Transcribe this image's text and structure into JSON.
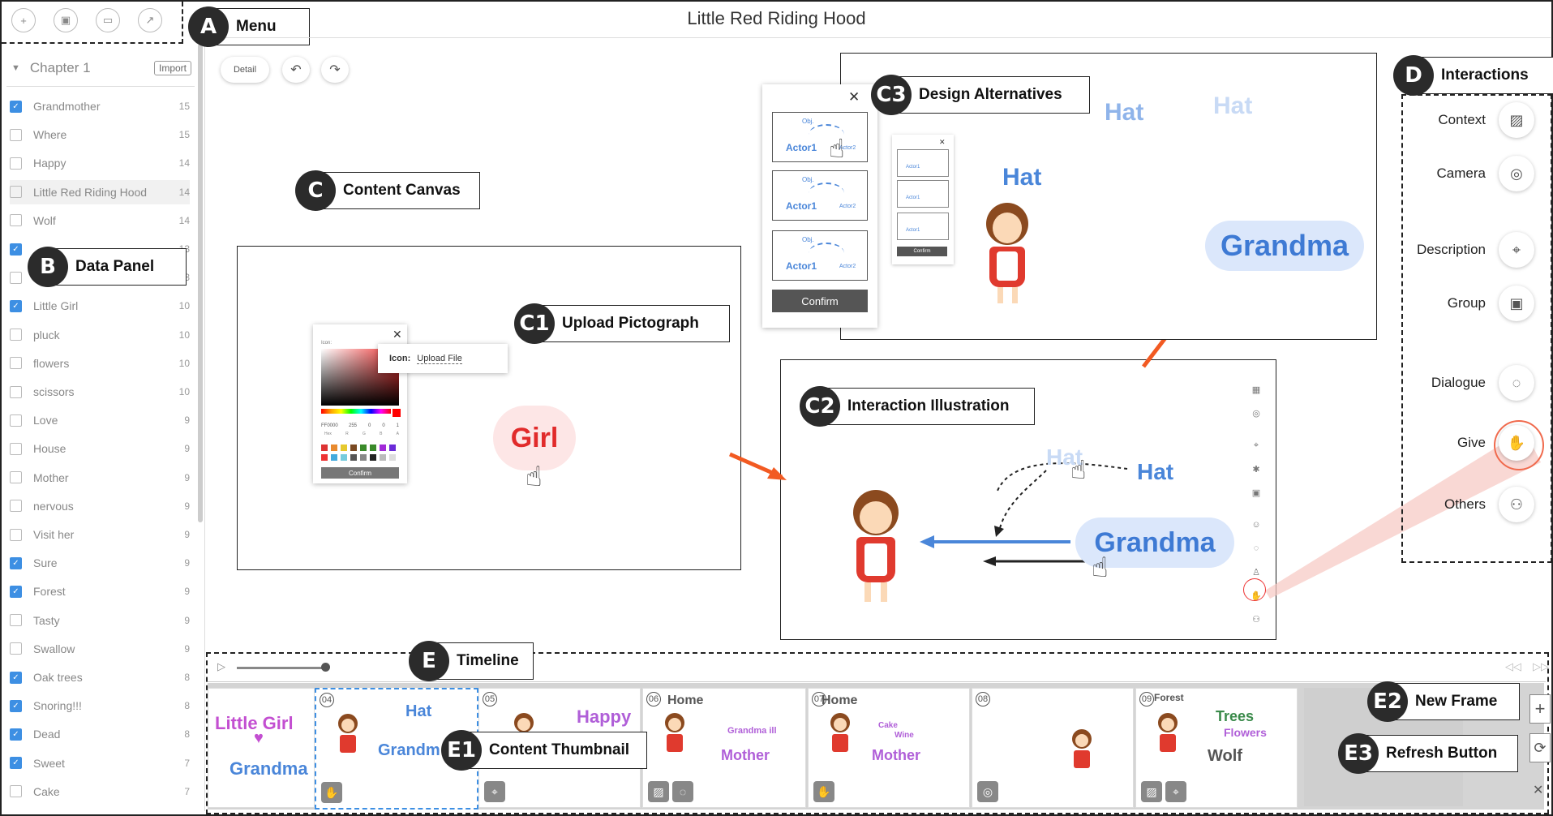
{
  "title": "Little Red Riding Hood",
  "callouts": {
    "a": {
      "letter": "A",
      "text": "Menu"
    },
    "b": {
      "letter": "B",
      "text": "Data Panel"
    },
    "c": {
      "letter": "C",
      "text": "Content Canvas"
    },
    "c1": {
      "letter": "C1",
      "text": "Upload Pictograph"
    },
    "c2": {
      "letter": "C2",
      "text": "Interaction Illustration"
    },
    "c3": {
      "letter": "C3",
      "text": "Design Alternatives"
    },
    "d": {
      "letter": "D",
      "text": "Interactions"
    },
    "e": {
      "letter": "E",
      "text": "Timeline"
    },
    "e1": {
      "letter": "E1",
      "text": "Content Thumbnail"
    },
    "e2": {
      "letter": "E2",
      "text": "New Frame"
    },
    "e3": {
      "letter": "E3",
      "text": "Refresh Button"
    }
  },
  "menu": {
    "icons": [
      "new-file-icon",
      "save-icon",
      "open-folder-icon",
      "export-icon"
    ]
  },
  "data_panel": {
    "chapter": "Chapter 1",
    "import_label": "Import",
    "items": [
      {
        "label": "Grandmother",
        "count": "15",
        "checked": true
      },
      {
        "label": "Where",
        "count": "15",
        "checked": false
      },
      {
        "label": "Happy",
        "count": "14",
        "checked": false
      },
      {
        "label": "Little Red Riding Hood",
        "count": "14",
        "checked": false
      },
      {
        "label": "Wolf",
        "count": "14",
        "checked": false
      },
      {
        "label": "",
        "count": "13",
        "checked": true
      },
      {
        "label": "",
        "count": "13",
        "checked": false
      },
      {
        "label": "Little Girl",
        "count": "10",
        "checked": true
      },
      {
        "label": "pluck",
        "count": "10",
        "checked": false
      },
      {
        "label": "flowers",
        "count": "10",
        "checked": false
      },
      {
        "label": "scissors",
        "count": "10",
        "checked": false
      },
      {
        "label": "Love",
        "count": "9",
        "checked": false
      },
      {
        "label": "House",
        "count": "9",
        "checked": false
      },
      {
        "label": "Mother",
        "count": "9",
        "checked": false
      },
      {
        "label": "nervous",
        "count": "9",
        "checked": false
      },
      {
        "label": "Visit her",
        "count": "9",
        "checked": false
      },
      {
        "label": "Sure",
        "count": "9",
        "checked": true
      },
      {
        "label": "Forest",
        "count": "9",
        "checked": true
      },
      {
        "label": "Tasty",
        "count": "9",
        "checked": false
      },
      {
        "label": "Swallow",
        "count": "9",
        "checked": false
      },
      {
        "label": "Oak trees",
        "count": "8",
        "checked": true
      },
      {
        "label": "Snoring!!!",
        "count": "8",
        "checked": true
      },
      {
        "label": "Dead",
        "count": "8",
        "checked": true
      },
      {
        "label": "Sweet",
        "count": "7",
        "checked": true
      },
      {
        "label": "Cake",
        "count": "7",
        "checked": false
      }
    ]
  },
  "toolbar": {
    "detail_label": "Detail",
    "undo": "↶",
    "redo": "↷"
  },
  "canvas": {
    "girl_label": "Girl",
    "color_picker": {
      "icon_label": "Icon:",
      "upload_label": "Upload File",
      "hex": "FF0000",
      "rgba": [
        "255",
        "0",
        "0",
        "1"
      ],
      "rgba_labels": [
        "Hex",
        "R",
        "G",
        "B",
        "A"
      ],
      "confirm": "Confirm"
    }
  },
  "illustration": {
    "hat": "Hat",
    "hat_faded": "Hat",
    "grandma": "Grandma"
  },
  "alternatives": {
    "actor1": "Actor1",
    "actor2": "Actor2",
    "obj": "Obj.",
    "confirm": "Confirm",
    "hat": "Hat",
    "hat_faded": "Hat",
    "grandma": "Grandma"
  },
  "interactions": {
    "items": [
      {
        "label": "Context",
        "icon": "hatch-icon"
      },
      {
        "label": "Camera",
        "icon": "camera-icon"
      },
      {
        "label": "Description",
        "icon": "tag-icon"
      },
      {
        "label": "Group",
        "icon": "group-icon"
      },
      {
        "label": "Dialogue",
        "icon": "speech-icon"
      },
      {
        "label": "Give",
        "icon": "give-hand-icon"
      },
      {
        "label": "Others",
        "icon": "people-icon"
      }
    ]
  },
  "timeline": {
    "frames": [
      {
        "num": "",
        "texts": [
          "Little Girl",
          "Grandma"
        ]
      },
      {
        "num": "04",
        "texts": [
          "Hat",
          "Grandm"
        ]
      },
      {
        "num": "05",
        "texts": [
          "Happy"
        ]
      },
      {
        "num": "06",
        "texts": [
          "Home",
          "Grandma ill",
          "Mother"
        ]
      },
      {
        "num": "07",
        "texts": [
          "Home",
          "Cake",
          "Wine",
          "Mother"
        ]
      },
      {
        "num": "08",
        "texts": []
      },
      {
        "num": "09",
        "texts": [
          "Forest",
          "Trees",
          "Flowers",
          "Wolf"
        ]
      }
    ]
  },
  "colors": {
    "blue": "#4a86d9",
    "red": "#e12b2b",
    "orange": "#f25a22",
    "purple": "#b05fd8"
  }
}
